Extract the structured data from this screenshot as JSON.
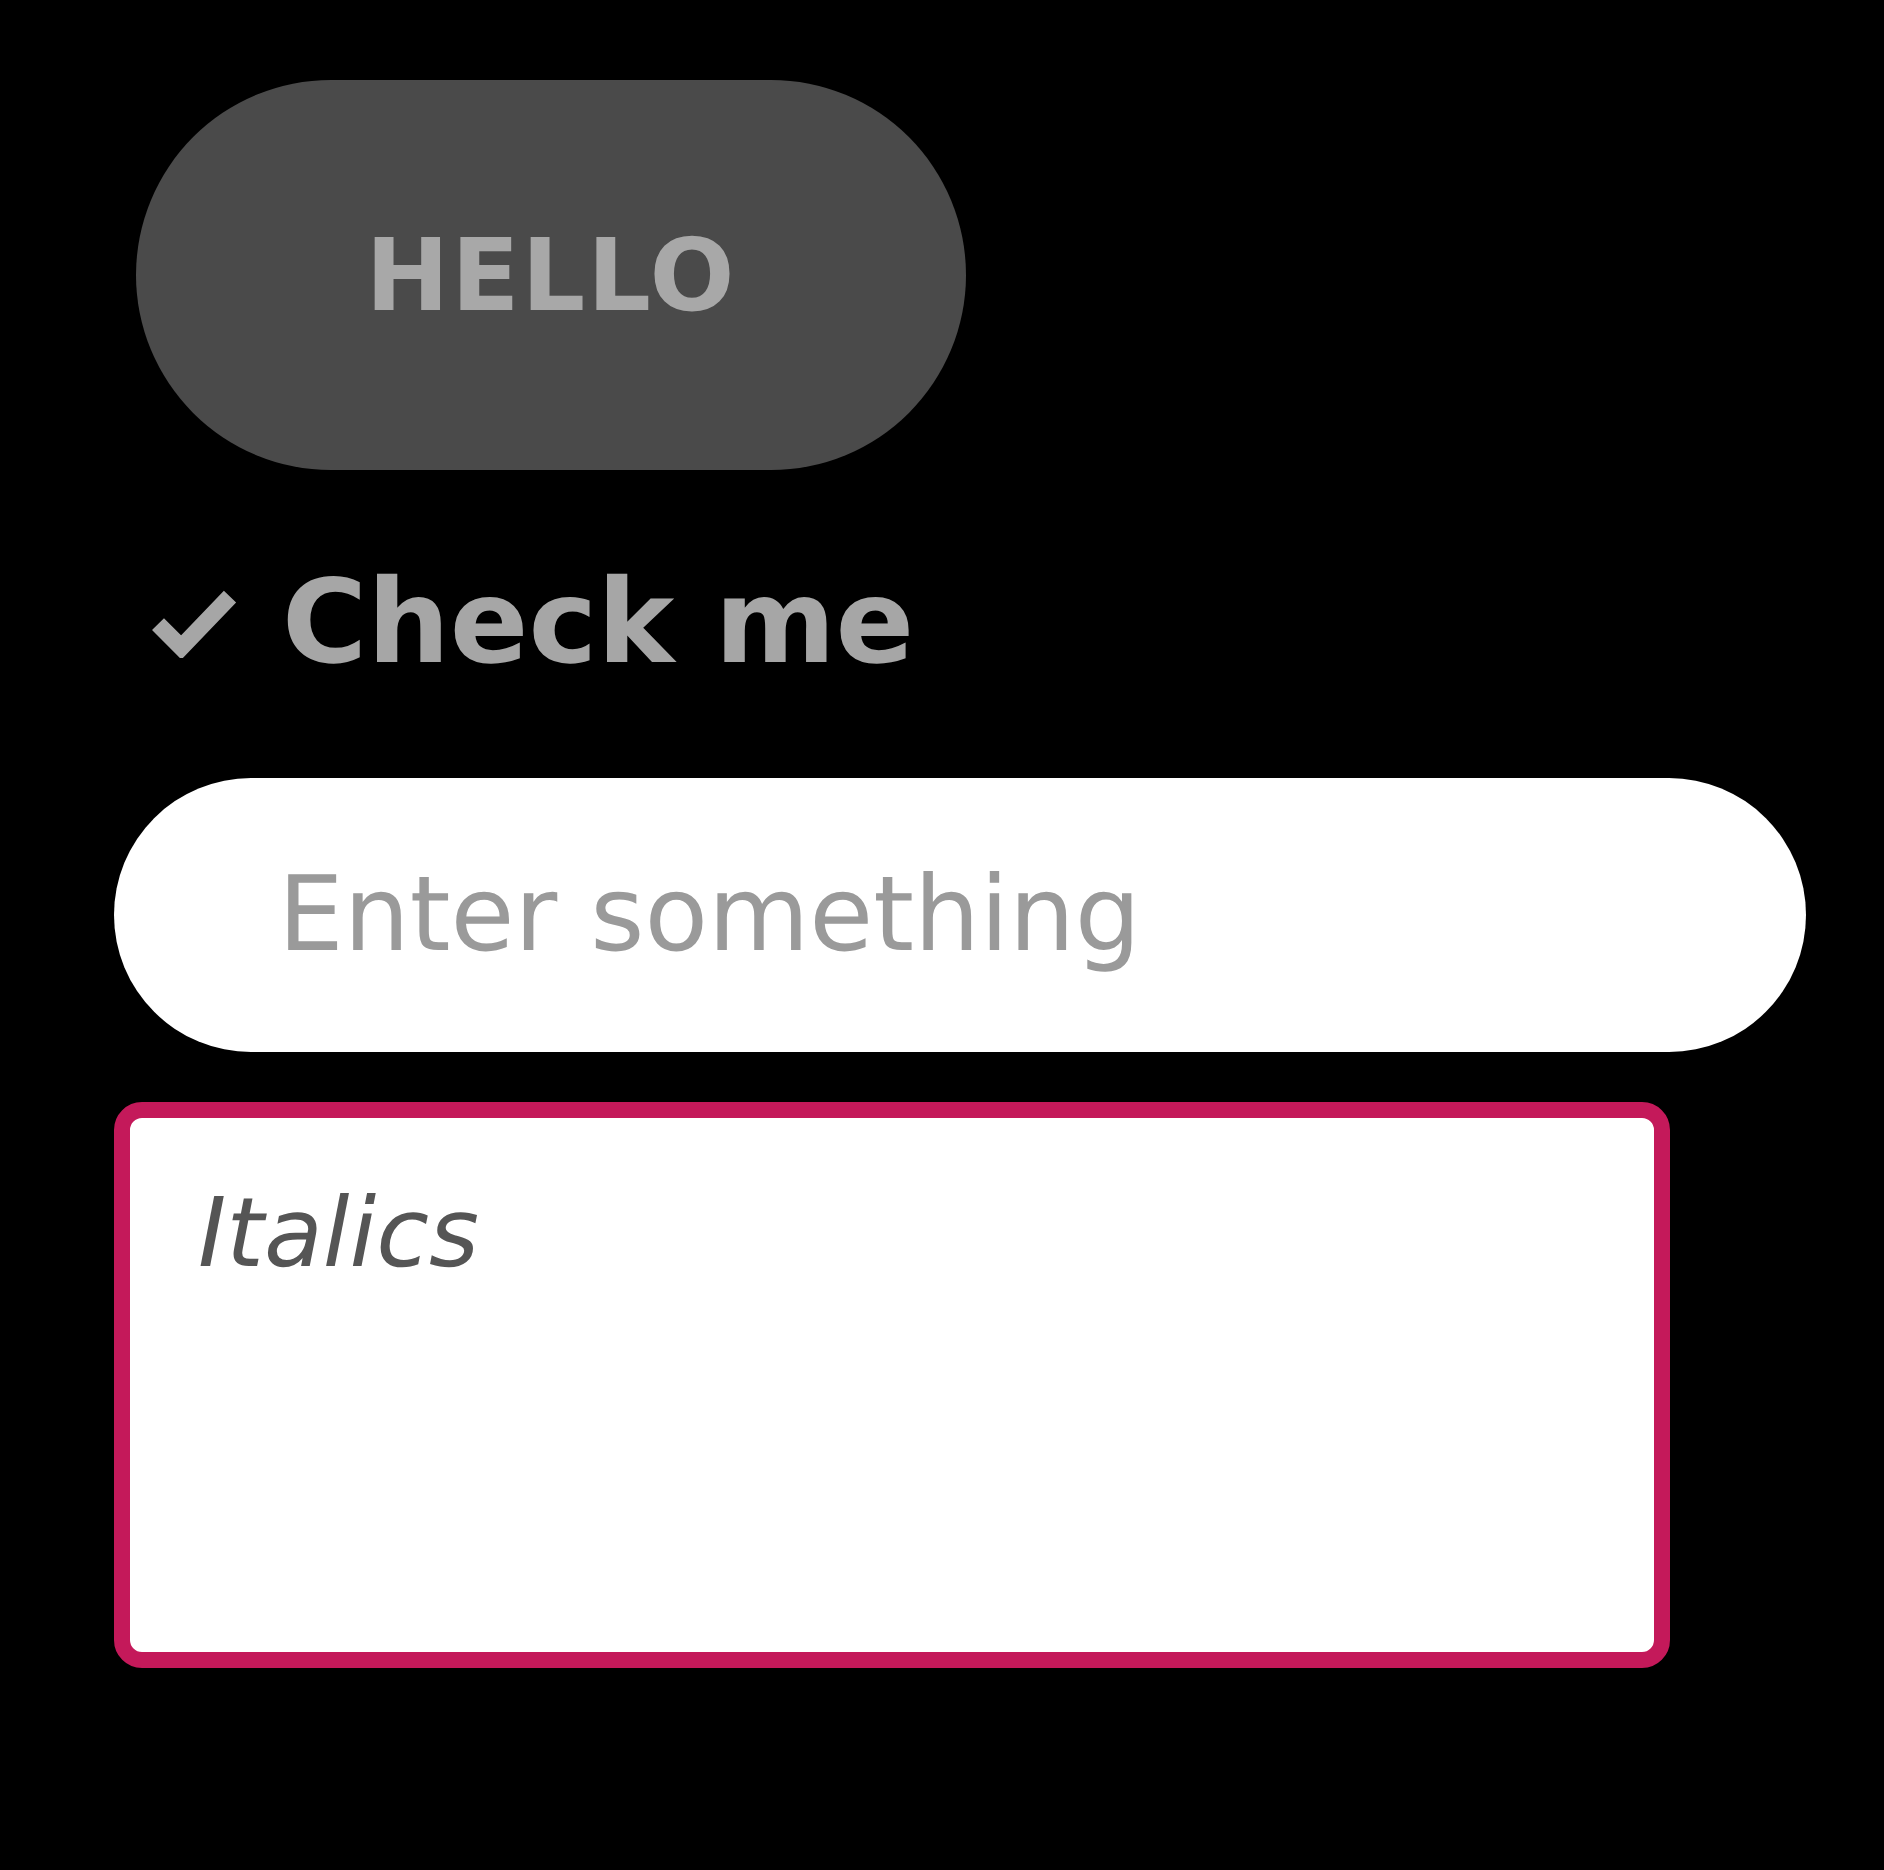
{
  "button": {
    "label": "HELLO"
  },
  "checkbox": {
    "label": "Check me",
    "checked": true
  },
  "input": {
    "placeholder": "Enter something"
  },
  "textarea": {
    "value": "Italics",
    "focused": true
  }
}
